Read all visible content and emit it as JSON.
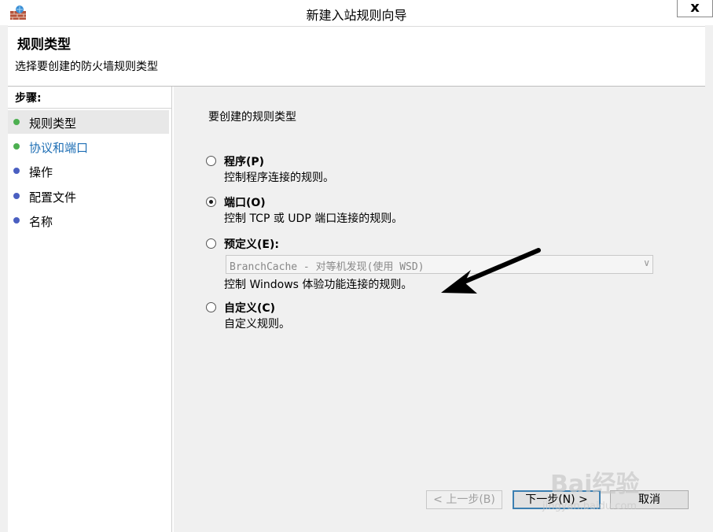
{
  "window": {
    "title": "新建入站规则向导",
    "close_label": "x"
  },
  "header": {
    "title": "规则类型",
    "subtitle": "选择要创建的防火墙规则类型"
  },
  "steps": {
    "heading": "步骤:",
    "items": [
      {
        "label": "规则类型",
        "dot_color": "#4caf50",
        "text_color": "#000000"
      },
      {
        "label": "协议和端口",
        "dot_color": "#4caf50",
        "text_color": "#1f6fb5"
      },
      {
        "label": "操作",
        "dot_color": "#4a5fc1",
        "text_color": "#000000"
      },
      {
        "label": "配置文件",
        "dot_color": "#4a5fc1",
        "text_color": "#000000"
      },
      {
        "label": "名称",
        "dot_color": "#4a5fc1",
        "text_color": "#000000"
      }
    ]
  },
  "main": {
    "prompt": "要创建的规则类型",
    "options": [
      {
        "label": "程序(P)",
        "desc": "控制程序连接的规则。",
        "selected": false
      },
      {
        "label": "端口(O)",
        "desc": "控制 TCP 或 UDP 端口连接的规则。",
        "selected": true
      },
      {
        "label": "预定义(E):",
        "desc": "控制 Windows 体验功能连接的规则。",
        "selected": false
      },
      {
        "label": "自定义(C)",
        "desc": "自定义规则。",
        "selected": false
      }
    ],
    "predefined_select": "BranchCache - 对等机发现(使用 WSD)"
  },
  "buttons": {
    "back": "< 上一步(B)",
    "next": "下一步(N) >",
    "cancel": "取消"
  },
  "watermark": {
    "main": "Bai经验",
    "sub": "jingyan.baidu.com"
  }
}
